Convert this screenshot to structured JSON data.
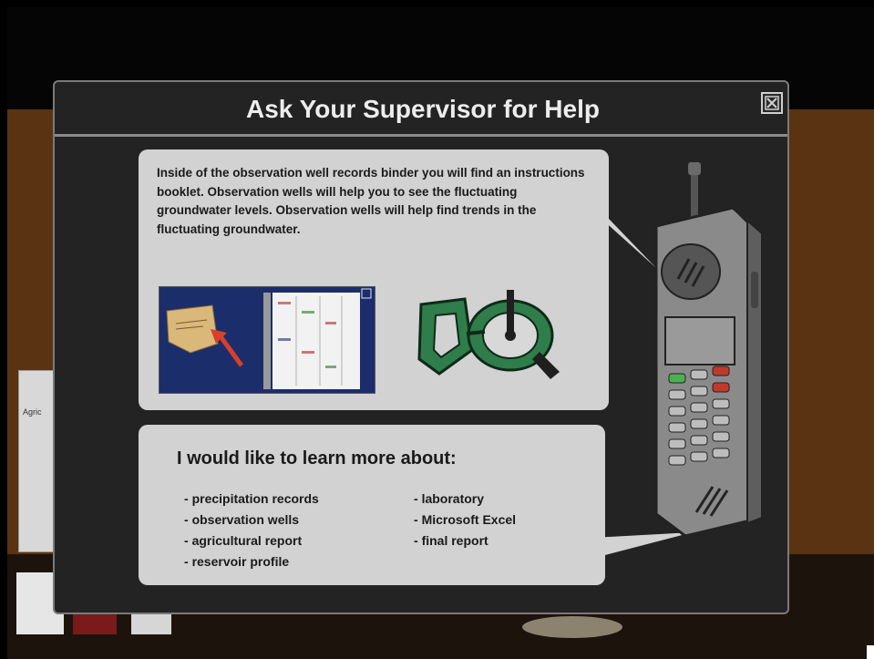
{
  "dialog": {
    "title": "Ask Your Supervisor for Help",
    "close_icon": "close-x-icon"
  },
  "message": {
    "text": "Inside of the observation well records binder you will find an instructions booklet.  Observation wells will help you to see the fluctuating groundwater levels. Observation wells will help find trends in the fluctuating groundwater."
  },
  "background": {
    "paper_label": "Agric"
  },
  "images": {
    "binder": "binder-image",
    "tape": "measuring-tape-image",
    "phone": "cell-phone-icon"
  },
  "learn_more": {
    "heading": "I would like to learn more about:",
    "left_topics": [
      "precipitation records",
      "observation wells",
      "agricultural report",
      "reservoir profile"
    ],
    "right_topics": [
      "laboratory",
      "Microsoft Excel",
      "final report"
    ]
  },
  "colors": {
    "dialog_bg": "#232323",
    "bubble_bg": "#d2d2d2",
    "binder_bg": "#1c2d6b",
    "tape_green": "#2e7d4a",
    "button_green": "#4caf50",
    "button_red": "#c0392b"
  }
}
